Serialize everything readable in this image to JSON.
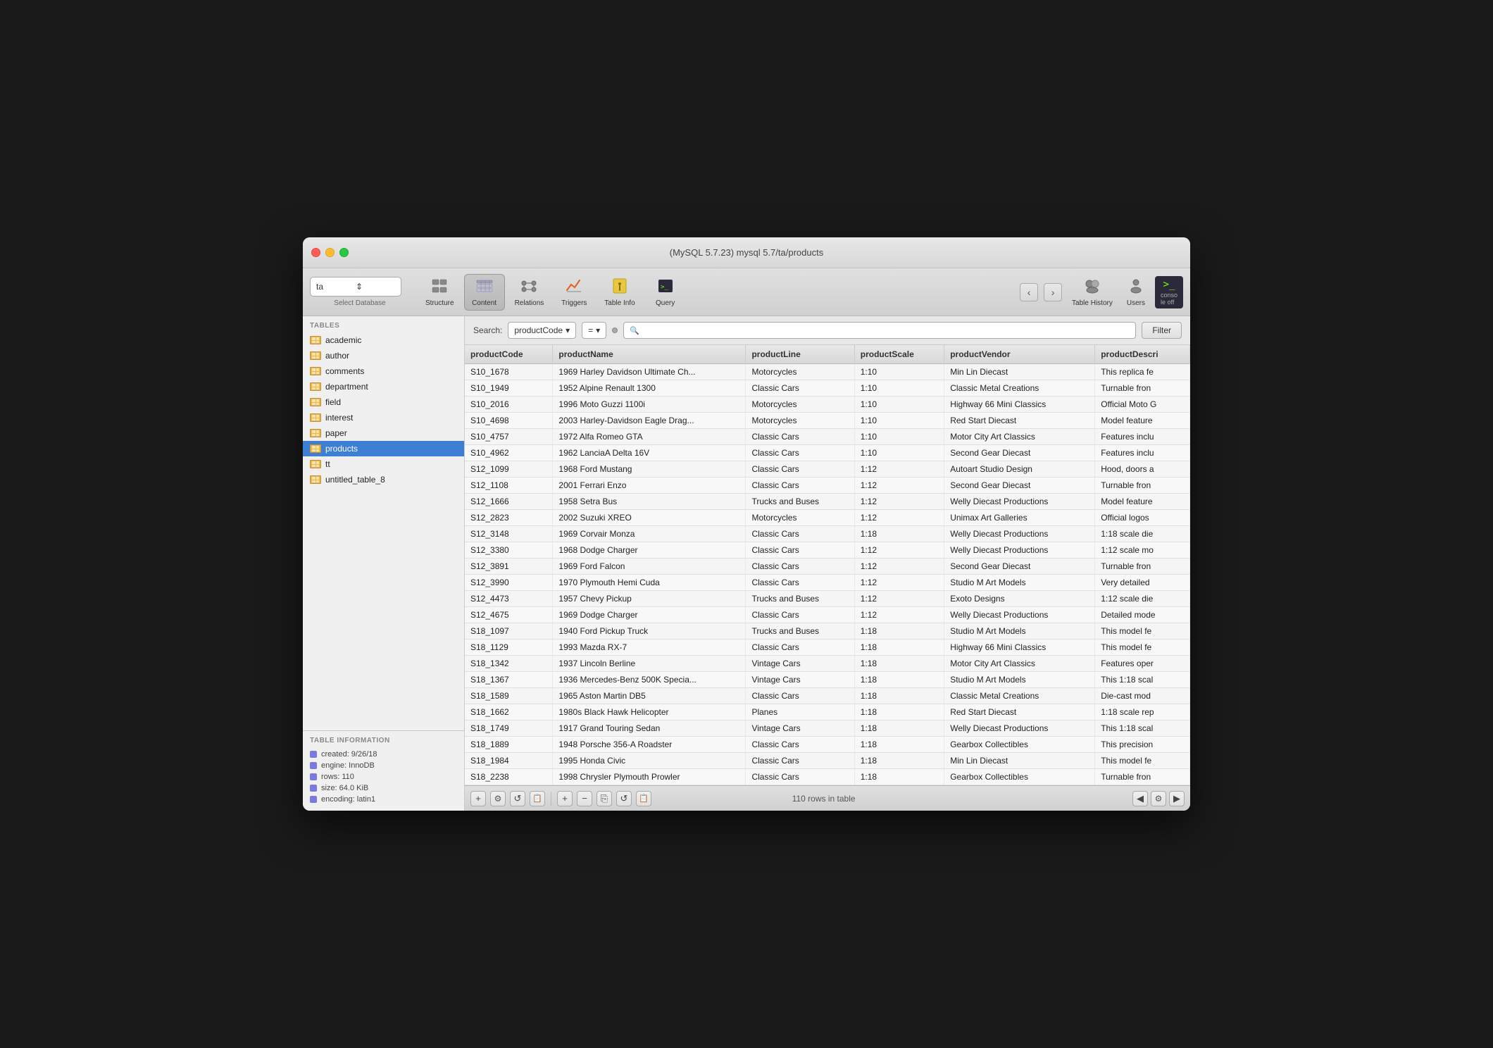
{
  "window": {
    "title": "(MySQL 5.7.23) mysql 5.7/ta/products"
  },
  "toolbar": {
    "db_selector": "ta",
    "db_label": "Select Database",
    "buttons": [
      {
        "id": "structure",
        "label": "Structure",
        "icon": "🗂"
      },
      {
        "id": "content",
        "label": "Content",
        "icon": "▦"
      },
      {
        "id": "relations",
        "label": "Relations",
        "icon": "⛓"
      },
      {
        "id": "triggers",
        "label": "Triggers",
        "icon": "📈"
      },
      {
        "id": "table_info",
        "label": "Table Info",
        "icon": "ℹ"
      },
      {
        "id": "query",
        "label": "Query",
        "icon": "⌨"
      }
    ],
    "history_label": "Table History",
    "users_label": "Users",
    "console_label": "Console",
    "console_text": "conso\nle off"
  },
  "sidebar": {
    "tables_header": "TABLES",
    "tables": [
      {
        "name": "academic"
      },
      {
        "name": "author"
      },
      {
        "name": "comments"
      },
      {
        "name": "department"
      },
      {
        "name": "field"
      },
      {
        "name": "interest"
      },
      {
        "name": "paper"
      },
      {
        "name": "products",
        "selected": true
      },
      {
        "name": "tt"
      },
      {
        "name": "untitled_table_8"
      }
    ],
    "info_header": "TABLE INFORMATION",
    "info_items": [
      {
        "label": "created: 9/26/18"
      },
      {
        "label": "engine: InnoDB"
      },
      {
        "label": "rows: 110"
      },
      {
        "label": "size: 64.0 KiB"
      },
      {
        "label": "encoding: latin1"
      }
    ]
  },
  "search": {
    "label": "Search:",
    "field": "productCode",
    "operator": "=",
    "value": "",
    "filter_btn": "Filter"
  },
  "table": {
    "columns": [
      "productCode",
      "productName",
      "productLine",
      "productScale",
      "productVendor",
      "productDescri"
    ],
    "rows": [
      {
        "productCode": "S10_1678",
        "productName": "1969 Harley Davidson Ultimate Ch...",
        "productLine": "Motorcycles",
        "productScale": "1:10",
        "productVendor": "Min Lin Diecast",
        "productDescri": "This replica fe"
      },
      {
        "productCode": "S10_1949",
        "productName": "1952 Alpine Renault 1300",
        "productLine": "Classic Cars",
        "productScale": "1:10",
        "productVendor": "Classic Metal Creations",
        "productDescri": "Turnable fron"
      },
      {
        "productCode": "S10_2016",
        "productName": "1996 Moto Guzzi 1100i",
        "productLine": "Motorcycles",
        "productScale": "1:10",
        "productVendor": "Highway 66 Mini Classics",
        "productDescri": "Official Moto G"
      },
      {
        "productCode": "S10_4698",
        "productName": "2003 Harley-Davidson Eagle Drag...",
        "productLine": "Motorcycles",
        "productScale": "1:10",
        "productVendor": "Red Start Diecast",
        "productDescri": "Model feature"
      },
      {
        "productCode": "S10_4757",
        "productName": "1972 Alfa Romeo GTA",
        "productLine": "Classic Cars",
        "productScale": "1:10",
        "productVendor": "Motor City Art Classics",
        "productDescri": "Features inclu"
      },
      {
        "productCode": "S10_4962",
        "productName": "1962 LanciaA Delta 16V",
        "productLine": "Classic Cars",
        "productScale": "1:10",
        "productVendor": "Second Gear Diecast",
        "productDescri": "Features inclu"
      },
      {
        "productCode": "S12_1099",
        "productName": "1968 Ford Mustang",
        "productLine": "Classic Cars",
        "productScale": "1:12",
        "productVendor": "Autoart Studio Design",
        "productDescri": "Hood, doors a"
      },
      {
        "productCode": "S12_1108",
        "productName": "2001 Ferrari Enzo",
        "productLine": "Classic Cars",
        "productScale": "1:12",
        "productVendor": "Second Gear Diecast",
        "productDescri": "Turnable fron"
      },
      {
        "productCode": "S12_1666",
        "productName": "1958 Setra Bus",
        "productLine": "Trucks and Buses",
        "productScale": "1:12",
        "productVendor": "Welly Diecast Productions",
        "productDescri": "Model feature"
      },
      {
        "productCode": "S12_2823",
        "productName": "2002 Suzuki XREO",
        "productLine": "Motorcycles",
        "productScale": "1:12",
        "productVendor": "Unimax Art Galleries",
        "productDescri": "Official logos"
      },
      {
        "productCode": "S12_3148",
        "productName": "1969 Corvair Monza",
        "productLine": "Classic Cars",
        "productScale": "1:18",
        "productVendor": "Welly Diecast Productions",
        "productDescri": "1:18 scale die"
      },
      {
        "productCode": "S12_3380",
        "productName": "1968 Dodge Charger",
        "productLine": "Classic Cars",
        "productScale": "1:12",
        "productVendor": "Welly Diecast Productions",
        "productDescri": "1:12 scale mo"
      },
      {
        "productCode": "S12_3891",
        "productName": "1969 Ford Falcon",
        "productLine": "Classic Cars",
        "productScale": "1:12",
        "productVendor": "Second Gear Diecast",
        "productDescri": "Turnable fron"
      },
      {
        "productCode": "S12_3990",
        "productName": "1970 Plymouth Hemi Cuda",
        "productLine": "Classic Cars",
        "productScale": "1:12",
        "productVendor": "Studio M Art Models",
        "productDescri": "Very detailed"
      },
      {
        "productCode": "S12_4473",
        "productName": "1957 Chevy Pickup",
        "productLine": "Trucks and Buses",
        "productScale": "1:12",
        "productVendor": "Exoto Designs",
        "productDescri": "1:12 scale die"
      },
      {
        "productCode": "S12_4675",
        "productName": "1969 Dodge Charger",
        "productLine": "Classic Cars",
        "productScale": "1:12",
        "productVendor": "Welly Diecast Productions",
        "productDescri": "Detailed mode"
      },
      {
        "productCode": "S18_1097",
        "productName": "1940 Ford Pickup Truck",
        "productLine": "Trucks and Buses",
        "productScale": "1:18",
        "productVendor": "Studio M Art Models",
        "productDescri": "This model fe"
      },
      {
        "productCode": "S18_1129",
        "productName": "1993 Mazda RX-7",
        "productLine": "Classic Cars",
        "productScale": "1:18",
        "productVendor": "Highway 66 Mini Classics",
        "productDescri": "This model fe"
      },
      {
        "productCode": "S18_1342",
        "productName": "1937 Lincoln Berline",
        "productLine": "Vintage Cars",
        "productScale": "1:18",
        "productVendor": "Motor City Art Classics",
        "productDescri": "Features oper"
      },
      {
        "productCode": "S18_1367",
        "productName": "1936 Mercedes-Benz 500K Specia...",
        "productLine": "Vintage Cars",
        "productScale": "1:18",
        "productVendor": "Studio M Art Models",
        "productDescri": "This 1:18 scal"
      },
      {
        "productCode": "S18_1589",
        "productName": "1965 Aston Martin DB5",
        "productLine": "Classic Cars",
        "productScale": "1:18",
        "productVendor": "Classic Metal Creations",
        "productDescri": "Die-cast mod"
      },
      {
        "productCode": "S18_1662",
        "productName": "1980s Black Hawk Helicopter",
        "productLine": "Planes",
        "productScale": "1:18",
        "productVendor": "Red Start Diecast",
        "productDescri": "1:18 scale rep"
      },
      {
        "productCode": "S18_1749",
        "productName": "1917 Grand Touring Sedan",
        "productLine": "Vintage Cars",
        "productScale": "1:18",
        "productVendor": "Welly Diecast Productions",
        "productDescri": "This 1:18 scal"
      },
      {
        "productCode": "S18_1889",
        "productName": "1948 Porsche 356-A Roadster",
        "productLine": "Classic Cars",
        "productScale": "1:18",
        "productVendor": "Gearbox Collectibles",
        "productDescri": "This precision"
      },
      {
        "productCode": "S18_1984",
        "productName": "1995 Honda Civic",
        "productLine": "Classic Cars",
        "productScale": "1:18",
        "productVendor": "Min Lin Diecast",
        "productDescri": "This model fe"
      },
      {
        "productCode": "S18_2238",
        "productName": "1998 Chrysler Plymouth Prowler",
        "productLine": "Classic Cars",
        "productScale": "1:18",
        "productVendor": "Gearbox Collectibles",
        "productDescri": "Turnable fron"
      }
    ]
  },
  "bottom_bar": {
    "rows_info": "110 rows in table",
    "add_icon": "+",
    "remove_icon": "−",
    "copy_icon": "⎘",
    "refresh_icon": "↺",
    "clipboard_icon": "📋",
    "gear_icon": "⚙",
    "prev_icon": "◀",
    "next_icon": "▶"
  }
}
